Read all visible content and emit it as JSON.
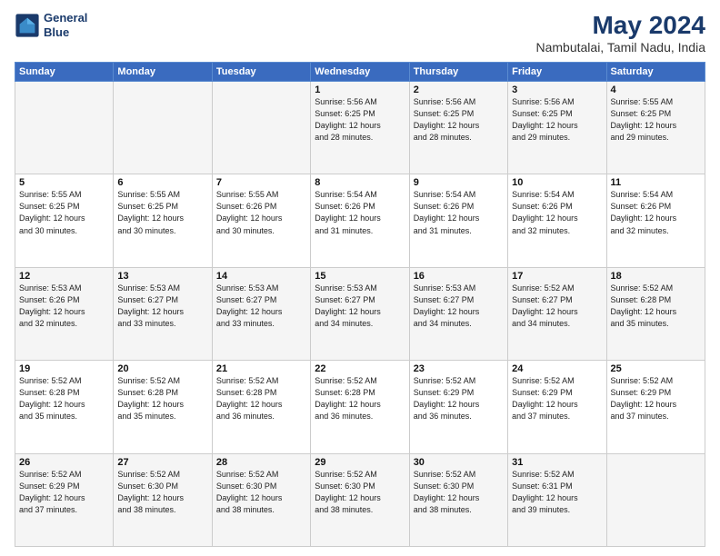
{
  "logo": {
    "line1": "General",
    "line2": "Blue"
  },
  "title": "May 2024",
  "subtitle": "Nambutalai, Tamil Nadu, India",
  "header": {
    "days": [
      "Sunday",
      "Monday",
      "Tuesday",
      "Wednesday",
      "Thursday",
      "Friday",
      "Saturday"
    ]
  },
  "weeks": [
    [
      {
        "day": "",
        "info": ""
      },
      {
        "day": "",
        "info": ""
      },
      {
        "day": "",
        "info": ""
      },
      {
        "day": "1",
        "info": "Sunrise: 5:56 AM\nSunset: 6:25 PM\nDaylight: 12 hours\nand 28 minutes."
      },
      {
        "day": "2",
        "info": "Sunrise: 5:56 AM\nSunset: 6:25 PM\nDaylight: 12 hours\nand 28 minutes."
      },
      {
        "day": "3",
        "info": "Sunrise: 5:56 AM\nSunset: 6:25 PM\nDaylight: 12 hours\nand 29 minutes."
      },
      {
        "day": "4",
        "info": "Sunrise: 5:55 AM\nSunset: 6:25 PM\nDaylight: 12 hours\nand 29 minutes."
      }
    ],
    [
      {
        "day": "5",
        "info": "Sunrise: 5:55 AM\nSunset: 6:25 PM\nDaylight: 12 hours\nand 30 minutes."
      },
      {
        "day": "6",
        "info": "Sunrise: 5:55 AM\nSunset: 6:25 PM\nDaylight: 12 hours\nand 30 minutes."
      },
      {
        "day": "7",
        "info": "Sunrise: 5:55 AM\nSunset: 6:26 PM\nDaylight: 12 hours\nand 30 minutes."
      },
      {
        "day": "8",
        "info": "Sunrise: 5:54 AM\nSunset: 6:26 PM\nDaylight: 12 hours\nand 31 minutes."
      },
      {
        "day": "9",
        "info": "Sunrise: 5:54 AM\nSunset: 6:26 PM\nDaylight: 12 hours\nand 31 minutes."
      },
      {
        "day": "10",
        "info": "Sunrise: 5:54 AM\nSunset: 6:26 PM\nDaylight: 12 hours\nand 32 minutes."
      },
      {
        "day": "11",
        "info": "Sunrise: 5:54 AM\nSunset: 6:26 PM\nDaylight: 12 hours\nand 32 minutes."
      }
    ],
    [
      {
        "day": "12",
        "info": "Sunrise: 5:53 AM\nSunset: 6:26 PM\nDaylight: 12 hours\nand 32 minutes."
      },
      {
        "day": "13",
        "info": "Sunrise: 5:53 AM\nSunset: 6:27 PM\nDaylight: 12 hours\nand 33 minutes."
      },
      {
        "day": "14",
        "info": "Sunrise: 5:53 AM\nSunset: 6:27 PM\nDaylight: 12 hours\nand 33 minutes."
      },
      {
        "day": "15",
        "info": "Sunrise: 5:53 AM\nSunset: 6:27 PM\nDaylight: 12 hours\nand 34 minutes."
      },
      {
        "day": "16",
        "info": "Sunrise: 5:53 AM\nSunset: 6:27 PM\nDaylight: 12 hours\nand 34 minutes."
      },
      {
        "day": "17",
        "info": "Sunrise: 5:52 AM\nSunset: 6:27 PM\nDaylight: 12 hours\nand 34 minutes."
      },
      {
        "day": "18",
        "info": "Sunrise: 5:52 AM\nSunset: 6:28 PM\nDaylight: 12 hours\nand 35 minutes."
      }
    ],
    [
      {
        "day": "19",
        "info": "Sunrise: 5:52 AM\nSunset: 6:28 PM\nDaylight: 12 hours\nand 35 minutes."
      },
      {
        "day": "20",
        "info": "Sunrise: 5:52 AM\nSunset: 6:28 PM\nDaylight: 12 hours\nand 35 minutes."
      },
      {
        "day": "21",
        "info": "Sunrise: 5:52 AM\nSunset: 6:28 PM\nDaylight: 12 hours\nand 36 minutes."
      },
      {
        "day": "22",
        "info": "Sunrise: 5:52 AM\nSunset: 6:28 PM\nDaylight: 12 hours\nand 36 minutes."
      },
      {
        "day": "23",
        "info": "Sunrise: 5:52 AM\nSunset: 6:29 PM\nDaylight: 12 hours\nand 36 minutes."
      },
      {
        "day": "24",
        "info": "Sunrise: 5:52 AM\nSunset: 6:29 PM\nDaylight: 12 hours\nand 37 minutes."
      },
      {
        "day": "25",
        "info": "Sunrise: 5:52 AM\nSunset: 6:29 PM\nDaylight: 12 hours\nand 37 minutes."
      }
    ],
    [
      {
        "day": "26",
        "info": "Sunrise: 5:52 AM\nSunset: 6:29 PM\nDaylight: 12 hours\nand 37 minutes."
      },
      {
        "day": "27",
        "info": "Sunrise: 5:52 AM\nSunset: 6:30 PM\nDaylight: 12 hours\nand 38 minutes."
      },
      {
        "day": "28",
        "info": "Sunrise: 5:52 AM\nSunset: 6:30 PM\nDaylight: 12 hours\nand 38 minutes."
      },
      {
        "day": "29",
        "info": "Sunrise: 5:52 AM\nSunset: 6:30 PM\nDaylight: 12 hours\nand 38 minutes."
      },
      {
        "day": "30",
        "info": "Sunrise: 5:52 AM\nSunset: 6:30 PM\nDaylight: 12 hours\nand 38 minutes."
      },
      {
        "day": "31",
        "info": "Sunrise: 5:52 AM\nSunset: 6:31 PM\nDaylight: 12 hours\nand 39 minutes."
      },
      {
        "day": "",
        "info": ""
      }
    ]
  ]
}
